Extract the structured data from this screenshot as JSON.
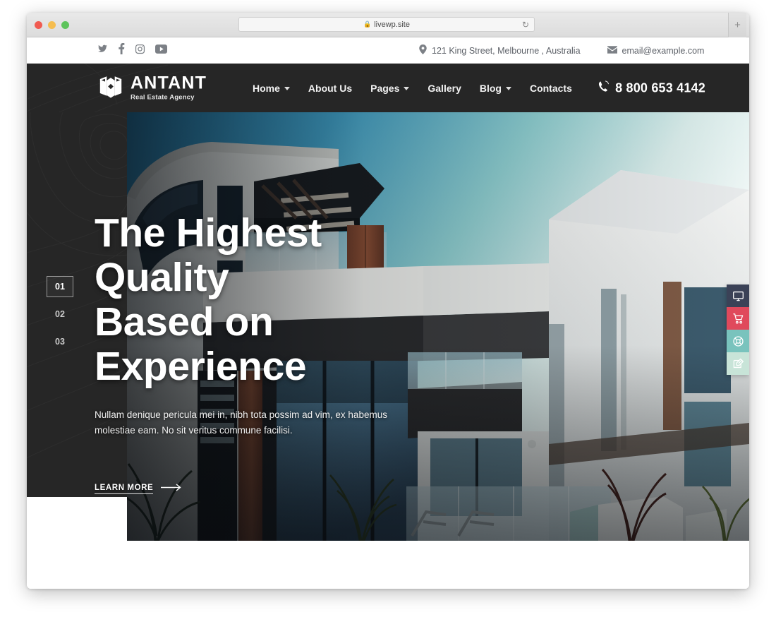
{
  "browser": {
    "url": "livewp.site",
    "lock_icon": "lock-icon",
    "reload_icon": "reload-icon",
    "new_tab_icon": "plus-icon",
    "traffic_lights": [
      "close-button",
      "minimize-button",
      "maximize-button"
    ]
  },
  "topbar": {
    "social": [
      {
        "name": "twitter-icon",
        "label": "Twitter"
      },
      {
        "name": "facebook-icon",
        "label": "Facebook"
      },
      {
        "name": "instagram-icon",
        "label": "Instagram"
      },
      {
        "name": "youtube-icon",
        "label": "YouTube"
      }
    ],
    "address": "121 King Street, Melbourne , Australia",
    "address_icon": "map-pin-icon",
    "email": "email@example.com",
    "email_icon": "envelope-icon"
  },
  "header": {
    "logo_name": "ANTANT",
    "logo_tagline": "Real Estate Agency",
    "logo_icon": "building-logo-icon",
    "nav": [
      {
        "label": "Home",
        "dropdown": true
      },
      {
        "label": "About Us",
        "dropdown": false
      },
      {
        "label": "Pages",
        "dropdown": true
      },
      {
        "label": "Gallery",
        "dropdown": false
      },
      {
        "label": "Blog",
        "dropdown": true
      },
      {
        "label": "Contacts",
        "dropdown": false
      }
    ],
    "phone": "8 800 653 4142",
    "phone_icon": "phone-icon",
    "background_color": "#262626"
  },
  "hero": {
    "title_line1": "The Highest Quality",
    "title_line2": "Based on Experience",
    "subtitle": "Nullam denique pericula mei in, nibh tota possim ad vim, ex habemus molestiae eam. No sit veritus commune facilisi.",
    "cta_label": "LEARN MORE",
    "cta_icon": "arrow-right-icon",
    "slides": [
      "01",
      "02",
      "03"
    ],
    "active_slide": "01"
  },
  "widget_rail": [
    {
      "name": "monitor-icon",
      "label": "Live Preview",
      "color": "#3b4257"
    },
    {
      "name": "cart-icon",
      "label": "Purchase",
      "color": "#e0495c"
    },
    {
      "name": "lifebuoy-icon",
      "label": "Support",
      "color": "#79c3bd"
    },
    {
      "name": "edit-icon",
      "label": "Customize",
      "color": "#c8e4d8"
    }
  ]
}
